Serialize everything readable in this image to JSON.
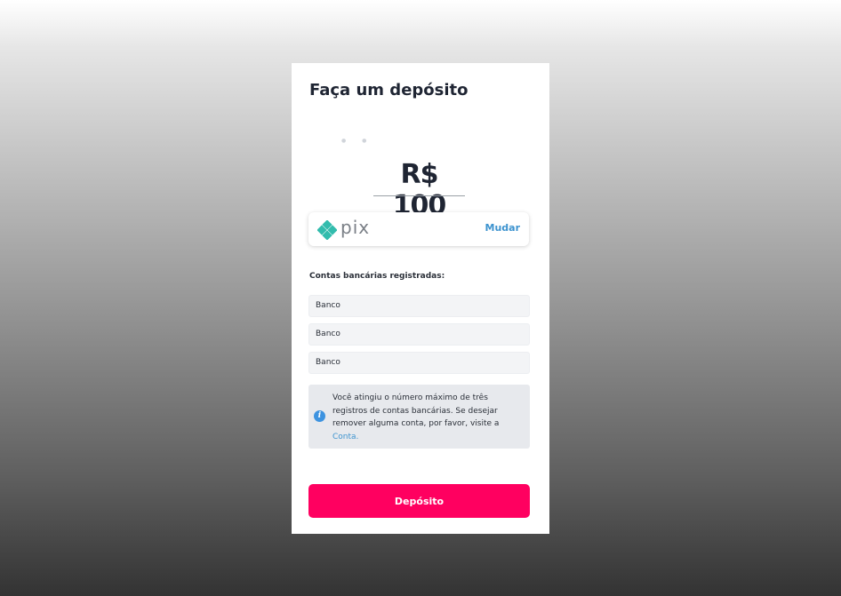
{
  "modal": {
    "title": "Faça um depósito",
    "amount": "R$ 100"
  },
  "payment_method": {
    "name": "pix",
    "icon": "pix-logo-icon",
    "change_label": "Mudar"
  },
  "accounts": {
    "label": "Contas bancárias registradas:",
    "items": [
      {
        "name": "Banco"
      },
      {
        "name": "Banco"
      },
      {
        "name": "Banco"
      }
    ]
  },
  "notice": {
    "icon": "info-icon",
    "text": "Você atingiu o número máximo de três registros de contas bancárias. Se desejar remover alguma conta, por favor, visite a",
    "link": "Conta."
  },
  "deposit_button": {
    "label": "Depósito"
  },
  "colors": {
    "accent": "#ff0060",
    "link": "#3d93cf",
    "pix": "#32bcad"
  }
}
